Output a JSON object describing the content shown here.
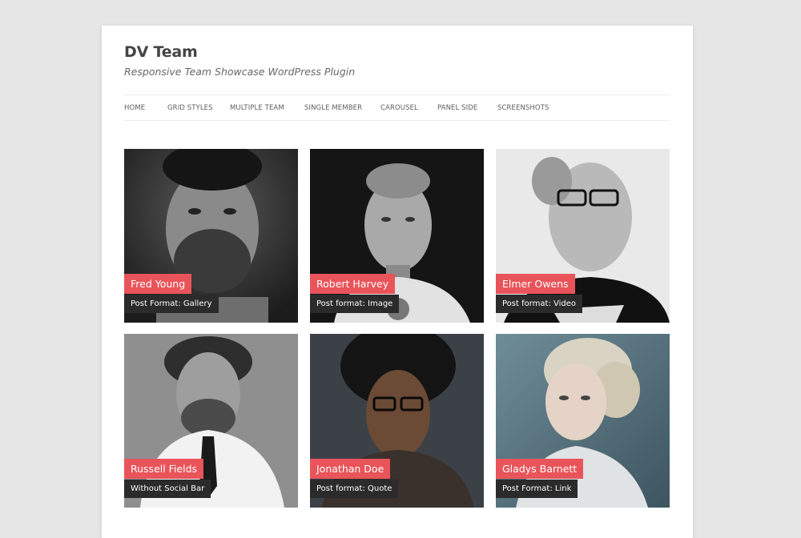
{
  "header": {
    "title": "DV Team",
    "description": "Responsive Team Showcase WordPress Plugin"
  },
  "nav": {
    "items": [
      {
        "label": "HOME"
      },
      {
        "label": "GRID STYLES"
      },
      {
        "label": "MULTIPLE TEAM"
      },
      {
        "label": "SINGLE MEMBER"
      },
      {
        "label": "CAROUSEL"
      },
      {
        "label": "PANEL SIDE"
      },
      {
        "label": "SCREENSHOTS"
      }
    ]
  },
  "colors": {
    "name_tag": "#e9545a",
    "format_tag": "#2b2b2b",
    "background": "#e6e6e6"
  },
  "team": [
    {
      "name": "Fred Young",
      "format": "Post Format: Gallery"
    },
    {
      "name": "Robert Harvey",
      "format": "Post format: Image"
    },
    {
      "name": "Elmer Owens",
      "format": "Post format: Video"
    },
    {
      "name": "Russell Fields",
      "format": "Without Social Bar"
    },
    {
      "name": "Jonathan Doe",
      "format": "Post format: Quote"
    },
    {
      "name": "Gladys Barnett",
      "format": "Post Format: Link"
    }
  ]
}
